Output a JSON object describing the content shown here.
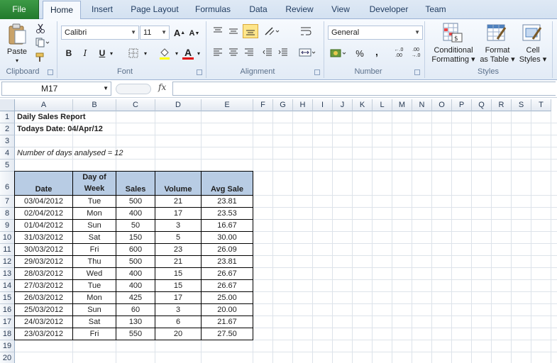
{
  "ribbon_tabs": [
    "File",
    "Home",
    "Insert",
    "Page Layout",
    "Formulas",
    "Data",
    "Review",
    "View",
    "Developer",
    "Team"
  ],
  "active_tab": "Home",
  "clipboard": {
    "paste_label": "Paste",
    "group_label": "Clipboard"
  },
  "font": {
    "name": "Calibri",
    "size": "11",
    "bold": "B",
    "italic": "I",
    "underline": "U",
    "grow": "A",
    "shrink": "A",
    "color_letter": "A",
    "group_label": "Font"
  },
  "alignment": {
    "group_label": "Alignment"
  },
  "number": {
    "format": "General",
    "percent": "%",
    "comma": ",",
    "inc_decimal": "+.0 .00",
    "dec_decimal": ".00 +.0",
    "group_label": "Number"
  },
  "styles": {
    "conditional": [
      "Conditional",
      "Formatting ▾"
    ],
    "format_table": [
      "Format",
      "as Table ▾"
    ],
    "cell_styles": [
      "Cell",
      "Styles ▾"
    ],
    "group_label": "Styles"
  },
  "formula_bar": {
    "cell_ref": "M17",
    "fx_label": "fx",
    "formula": ""
  },
  "columns": [
    "A",
    "B",
    "C",
    "D",
    "E",
    "F",
    "G",
    "H",
    "I",
    "J",
    "K",
    "L",
    "M",
    "N",
    "O",
    "P",
    "Q",
    "R",
    "S",
    "T"
  ],
  "rows": [
    "1",
    "2",
    "3",
    "4",
    "5",
    "6",
    "7",
    "8",
    "9",
    "10",
    "11",
    "12",
    "13",
    "14",
    "15",
    "16",
    "17",
    "18",
    "19",
    "20"
  ],
  "report": {
    "title": "Daily Sales Report",
    "todays_date": "Todays Date: 04/Apr/12",
    "days_analysed": "Number of days analysed = 12"
  },
  "table": {
    "headers": [
      "Date",
      "Day of Week",
      "Sales",
      "Volume",
      "Avg Sale"
    ],
    "header_lines": {
      "day_of": "Day of",
      "week": "Week"
    },
    "rows": [
      [
        "03/04/2012",
        "Tue",
        "500",
        "21",
        "23.81"
      ],
      [
        "02/04/2012",
        "Mon",
        "400",
        "17",
        "23.53"
      ],
      [
        "01/04/2012",
        "Sun",
        "50",
        "3",
        "16.67"
      ],
      [
        "31/03/2012",
        "Sat",
        "150",
        "5",
        "30.00"
      ],
      [
        "30/03/2012",
        "Fri",
        "600",
        "23",
        "26.09"
      ],
      [
        "29/03/2012",
        "Thu",
        "500",
        "21",
        "23.81"
      ],
      [
        "28/03/2012",
        "Wed",
        "400",
        "15",
        "26.67"
      ],
      [
        "27/03/2012",
        "Tue",
        "400",
        "15",
        "26.67"
      ],
      [
        "26/03/2012",
        "Mon",
        "425",
        "17",
        "25.00"
      ],
      [
        "25/03/2012",
        "Sun",
        "60",
        "3",
        "20.00"
      ],
      [
        "24/03/2012",
        "Sat",
        "130",
        "6",
        "21.67"
      ],
      [
        "23/03/2012",
        "Fri",
        "550",
        "20",
        "27.50"
      ]
    ]
  },
  "colors": {
    "header_fill": "#b8cce4",
    "file_tab": "#217a2c"
  }
}
